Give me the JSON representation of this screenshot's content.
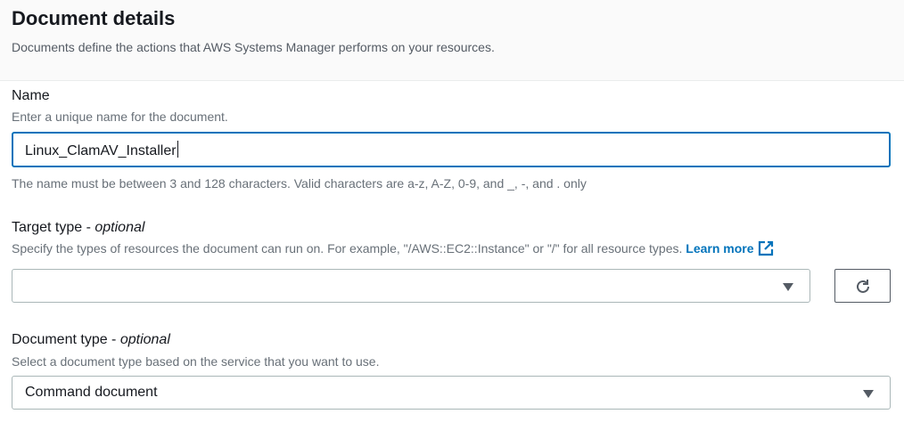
{
  "section": {
    "title": "Document details",
    "description": "Documents define the actions that AWS Systems Manager performs on your resources."
  },
  "name_field": {
    "label": "Name",
    "description": "Enter a unique name for the document.",
    "value": "Linux_ClamAV_Installer",
    "constraint": "The name must be between 3 and 128 characters. Valid characters are a-z, A-Z, 0-9, and _, -, and . only"
  },
  "target_type": {
    "label": "Target type - ",
    "optional": "optional",
    "description": "Specify the types of resources the document can run on. For example, \"/AWS::EC2::Instance\" or \"/\" for all resource types.",
    "learn_more": "Learn more",
    "value": ""
  },
  "document_type": {
    "label": "Document type - ",
    "optional": "optional",
    "description": "Select a document type based on the service that you want to use.",
    "value": "Command document"
  },
  "colors": {
    "accent": "#0073bb",
    "text": "#16191f",
    "secondary_text": "#687078"
  }
}
